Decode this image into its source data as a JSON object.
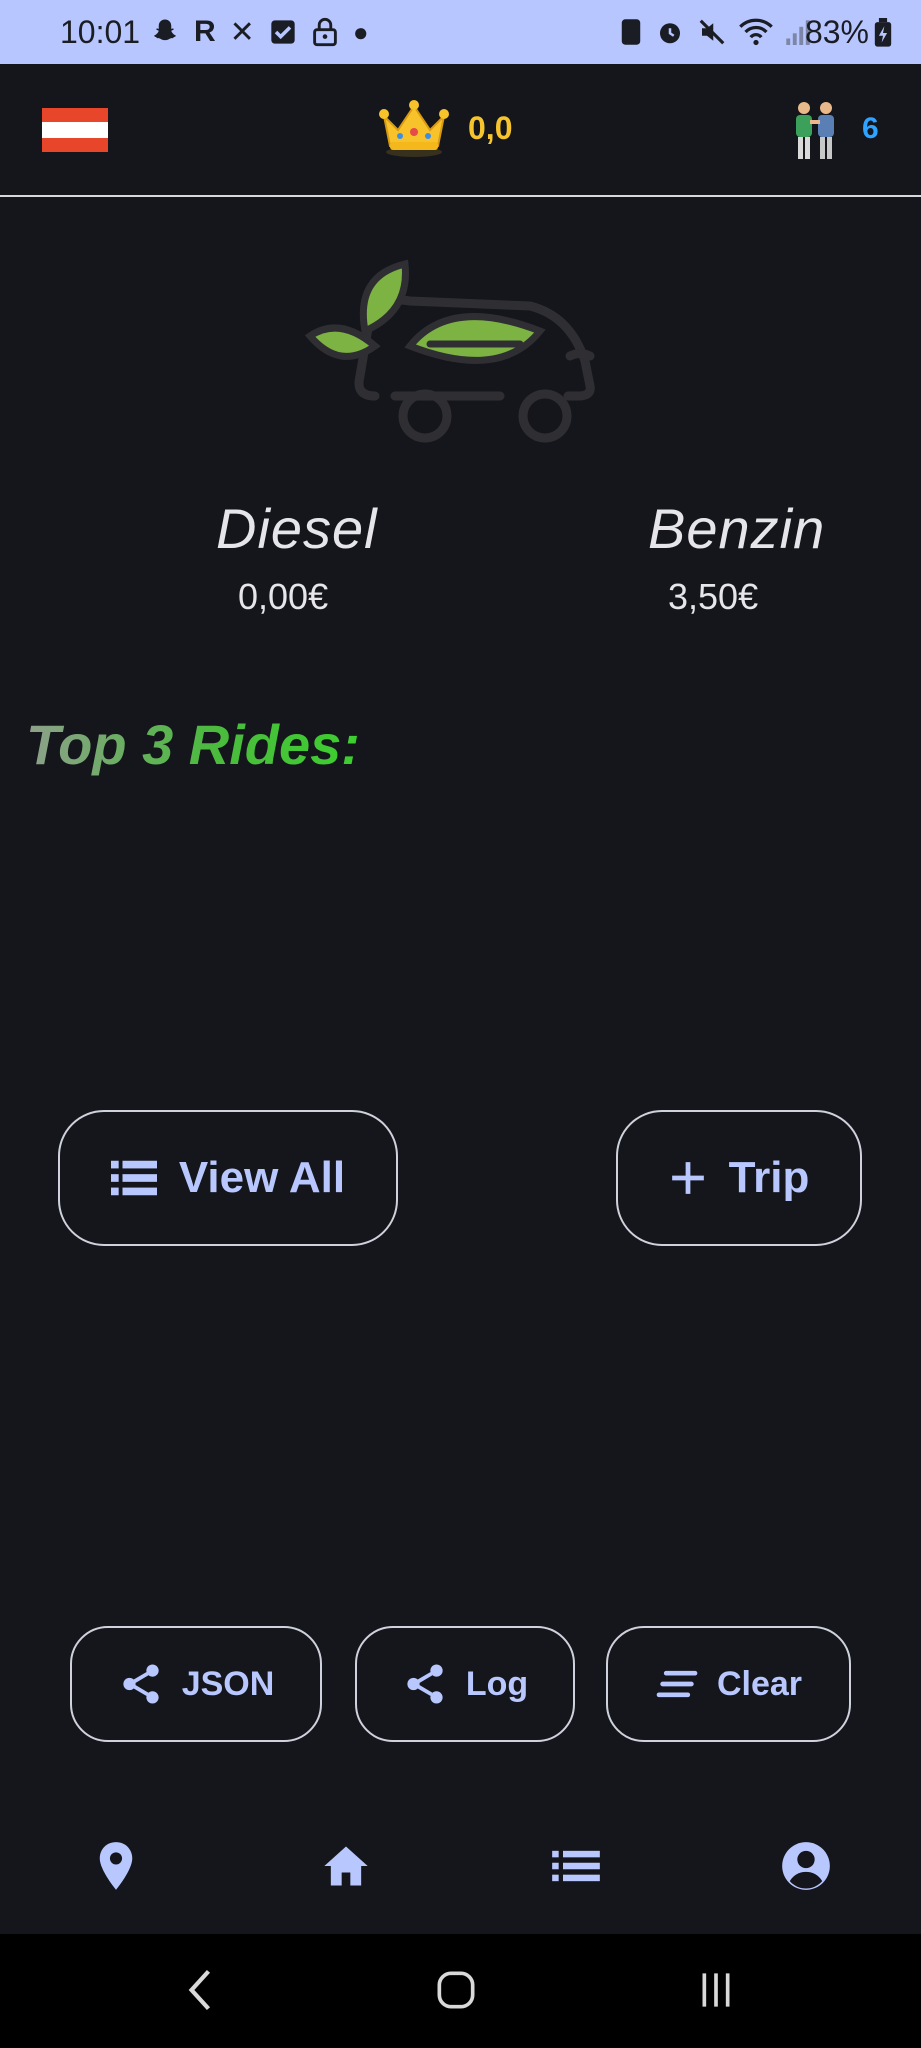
{
  "status_bar": {
    "time": "10:01",
    "battery": "83%"
  },
  "header": {
    "score": "0,0",
    "user_count": "6"
  },
  "prices": {
    "diesel": {
      "label": "Diesel",
      "value": "0,00€"
    },
    "benzin": {
      "label": "Benzin",
      "value": "3,50€"
    }
  },
  "top_rides": {
    "heading": "Top 3 Rides:"
  },
  "actions": {
    "view_all": "View All",
    "add_trip": "Trip"
  },
  "export": {
    "json": "JSON",
    "log": "Log",
    "clear": "Clear"
  },
  "icons": {
    "flag": "austria-flag-icon",
    "crown": "crown-icon",
    "users": "two-people-icon",
    "logo": "eco-car-leaf-icon",
    "nav": [
      "location-pin-icon",
      "home-icon",
      "list-icon",
      "account-circle-icon"
    ]
  },
  "colors": {
    "background": "#14161b",
    "status_bar": "#b8c6ff",
    "accent": "#b9c7ff",
    "score": "#f6c42c",
    "user_count": "#2ea3ff",
    "heading_green": "#3ccf2e"
  }
}
